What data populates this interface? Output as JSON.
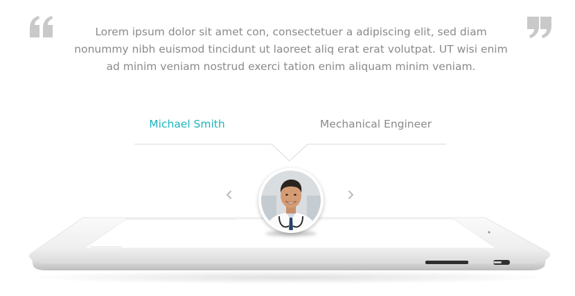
{
  "testimonial": {
    "quote": "Lorem ipsum dolor sit amet con, consectetuer a adipiscing elit, sed diam nonummy nibh euismod tincidunt ut laoreet aliq erat erat volutpat. UT wisi enim ad minim veniam nostrud exerci tation enim aliquam minim veniam.",
    "author_name": "Michael Smith",
    "author_role": "Mechanical Engineer"
  },
  "icons": {
    "quote_open": "quote-open-icon",
    "quote_close": "quote-close-icon",
    "prev": "chevron-left-icon",
    "next": "chevron-right-icon"
  },
  "colors": {
    "accent": "#1ab5bd",
    "text": "#8a8a8a",
    "quote_mark": "#c9c9c9",
    "divider": "#d8d8d8"
  }
}
